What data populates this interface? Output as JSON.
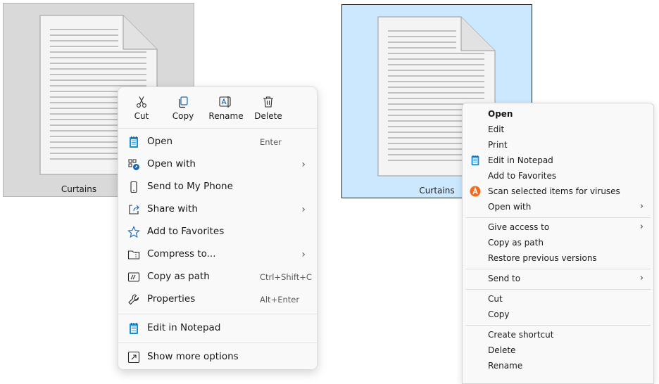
{
  "file_left": {
    "name": "Curtains"
  },
  "file_right": {
    "name": "Curtains"
  },
  "modern_menu": {
    "quick_actions": [
      {
        "label": "Cut",
        "icon": "scissors-icon"
      },
      {
        "label": "Copy",
        "icon": "copy-icon"
      },
      {
        "label": "Rename",
        "icon": "rename-icon"
      },
      {
        "label": "Delete",
        "icon": "trash-icon"
      }
    ],
    "items": [
      {
        "label": "Open",
        "shortcut": "Enter",
        "icon": "notepad-icon"
      },
      {
        "label": "Open with",
        "icon": "open-with-icon",
        "submenu": true
      },
      {
        "label": "Send to My Phone",
        "icon": "phone-icon"
      },
      {
        "label": "Share with",
        "icon": "share-icon",
        "submenu": true
      },
      {
        "label": "Add to Favorites",
        "icon": "star-icon"
      },
      {
        "label": "Compress to...",
        "icon": "folder-zip-icon",
        "submenu": true
      },
      {
        "label": "Copy as path",
        "shortcut": "Ctrl+Shift+C",
        "icon": "copy-path-icon"
      },
      {
        "label": "Properties",
        "shortcut": "Alt+Enter",
        "icon": "wrench-icon"
      },
      {
        "label": "Edit in Notepad",
        "icon": "notepad-icon"
      },
      {
        "label": "Show more options",
        "icon": "show-more-icon"
      }
    ],
    "chevron": "›"
  },
  "classic_menu": {
    "items": [
      {
        "label": "Open",
        "bold": true
      },
      {
        "label": "Edit"
      },
      {
        "label": "Print"
      },
      {
        "label": "Edit in Notepad",
        "icon": "notepad-icon"
      },
      {
        "label": "Add to Favorites"
      },
      {
        "label": "Scan selected items for viruses",
        "icon": "antivirus-icon"
      },
      {
        "label": "Open with",
        "submenu": true
      },
      {
        "label": "Give access to",
        "submenu": true
      },
      {
        "label": "Copy as path"
      },
      {
        "label": "Restore previous versions"
      },
      {
        "label": "Send to",
        "submenu": true
      },
      {
        "label": "Cut"
      },
      {
        "label": "Copy"
      },
      {
        "label": "Create shortcut"
      },
      {
        "label": "Delete"
      },
      {
        "label": "Rename"
      }
    ],
    "chevron": "›"
  },
  "colors": {
    "selected_bg": "#cce8ff",
    "unselected_bg": "#d9d9d9",
    "accent_blue": "#0067c0",
    "antivirus_orange": "#f26b1d"
  }
}
